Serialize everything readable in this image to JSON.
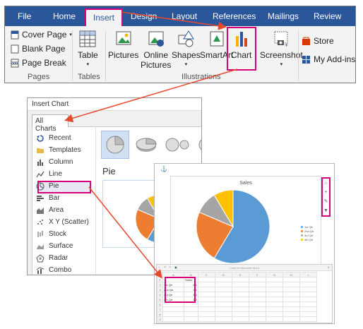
{
  "ribbon": {
    "tabs": [
      "File",
      "Home",
      "Insert",
      "Design",
      "Layout",
      "References",
      "Mailings",
      "Review"
    ],
    "active_tab": "Insert",
    "pages": {
      "cover_page": "Cover Page",
      "blank_page": "Blank Page",
      "page_break": "Page Break",
      "label": "Pages"
    },
    "tables": {
      "table": "Table",
      "label": "Tables"
    },
    "illustrations": {
      "pictures": "Pictures",
      "online_pictures_1": "Online",
      "online_pictures_2": "Pictures",
      "shapes": "Shapes",
      "smartart": "SmartArt",
      "chart": "Chart",
      "screenshot": "Screenshot",
      "label": "Illustrations"
    },
    "addins": {
      "store": "Store",
      "my_addins": "My Add-ins"
    }
  },
  "dialog": {
    "title": "Insert Chart",
    "tab": "All Charts",
    "types": [
      "Recent",
      "Templates",
      "Column",
      "Line",
      "Pie",
      "Bar",
      "Area",
      "X Y (Scatter)",
      "Stock",
      "Surface",
      "Radar",
      "Combo"
    ],
    "selected_type": "Pie",
    "heading": "Pie"
  },
  "chart_panel": {
    "chart_title": "Sales",
    "sheet_title": "Chart in Microsoft Word",
    "column_headers": [
      "",
      "A",
      "B",
      "C",
      "D",
      "E",
      "F",
      "G",
      "H",
      "I"
    ],
    "rows": [
      [
        "1",
        "",
        "Sales"
      ],
      [
        "2",
        "1st Qtr",
        "8.2"
      ],
      [
        "3",
        "2nd Qtr",
        "3.2"
      ],
      [
        "4",
        "3rd Qtr",
        "1.4"
      ],
      [
        "5",
        "4th Qtr",
        "1.2"
      ],
      [
        "6",
        "",
        ""
      ],
      [
        "7",
        "",
        ""
      ],
      [
        "8",
        "",
        ""
      ],
      [
        "9",
        "",
        ""
      ]
    ]
  },
  "chart_data": {
    "type": "pie",
    "title": "Sales",
    "categories": [
      "1st Qtr",
      "2nd Qtr",
      "3rd Qtr",
      "4th Qtr"
    ],
    "values": [
      8.2,
      3.2,
      1.4,
      1.2
    ],
    "colors": [
      "#5b9bd5",
      "#ed7d31",
      "#a5a5a5",
      "#ffc000"
    ],
    "legend": "right"
  },
  "colors": {
    "ribbon_blue": "#2b579a",
    "highlight": "#d6007b",
    "arrow": "#e64a2e"
  }
}
